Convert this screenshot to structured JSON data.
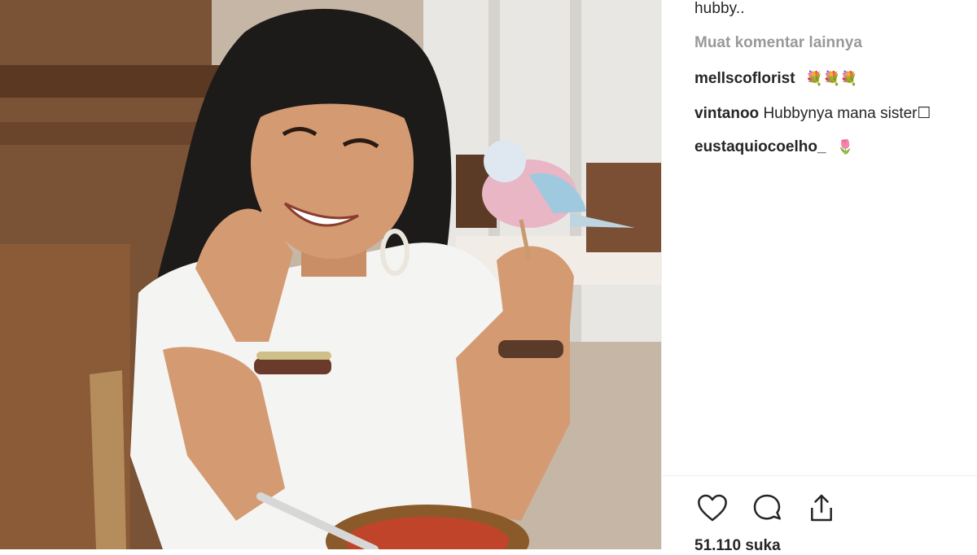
{
  "post": {
    "caption_tail": "hubby..",
    "load_more_label": "Muat komentar lainnya",
    "comments": [
      {
        "username": "mellscoflorist",
        "text": "",
        "emoji": "💐💐💐"
      },
      {
        "username": "vintanoo",
        "text": "Hubbynya mana sister",
        "emoji": "☐"
      },
      {
        "username": "eustaquiocoelho_",
        "text": "",
        "emoji": "🌷"
      }
    ],
    "likes_label": "51.110 suka"
  },
  "icons": {
    "like": "heart-icon",
    "comment": "speech-bubble-icon",
    "share": "share-icon"
  },
  "colors": {
    "text": "#262626",
    "muted": "#999999",
    "divider": "#efefef"
  }
}
